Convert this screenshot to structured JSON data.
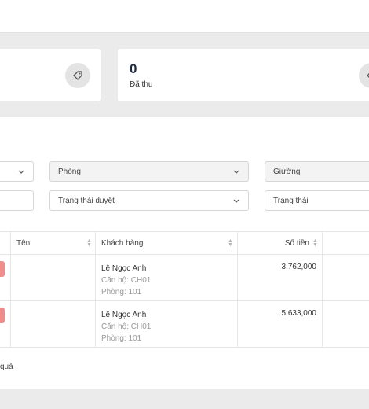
{
  "cards": [
    {
      "value": "",
      "label": ""
    },
    {
      "value": "0",
      "label": "Đã thu"
    }
  ],
  "filters": {
    "first": "",
    "room": "Phòng",
    "bed": "Giường",
    "second": "",
    "approval_status": "Trạng thái duyệt",
    "status": "Trạng thái"
  },
  "table": {
    "headers": {
      "name": "Tên",
      "customer": "Khách hàng",
      "amount": "Số tiền"
    },
    "rows": [
      {
        "customer": "Lê Ngọc Anh",
        "apartment": "Căn hộ: CH01",
        "room": "Phòng: 101",
        "amount": "3,762,000"
      },
      {
        "customer": "Lê Ngọc Anh",
        "apartment": "Căn hộ: CH01",
        "room": "Phòng: 101",
        "amount": "5,633,000"
      }
    ]
  },
  "footer": {
    "text": "quả"
  },
  "colors": {
    "tag": "#ef8d8d",
    "number": "#1f2a44"
  }
}
